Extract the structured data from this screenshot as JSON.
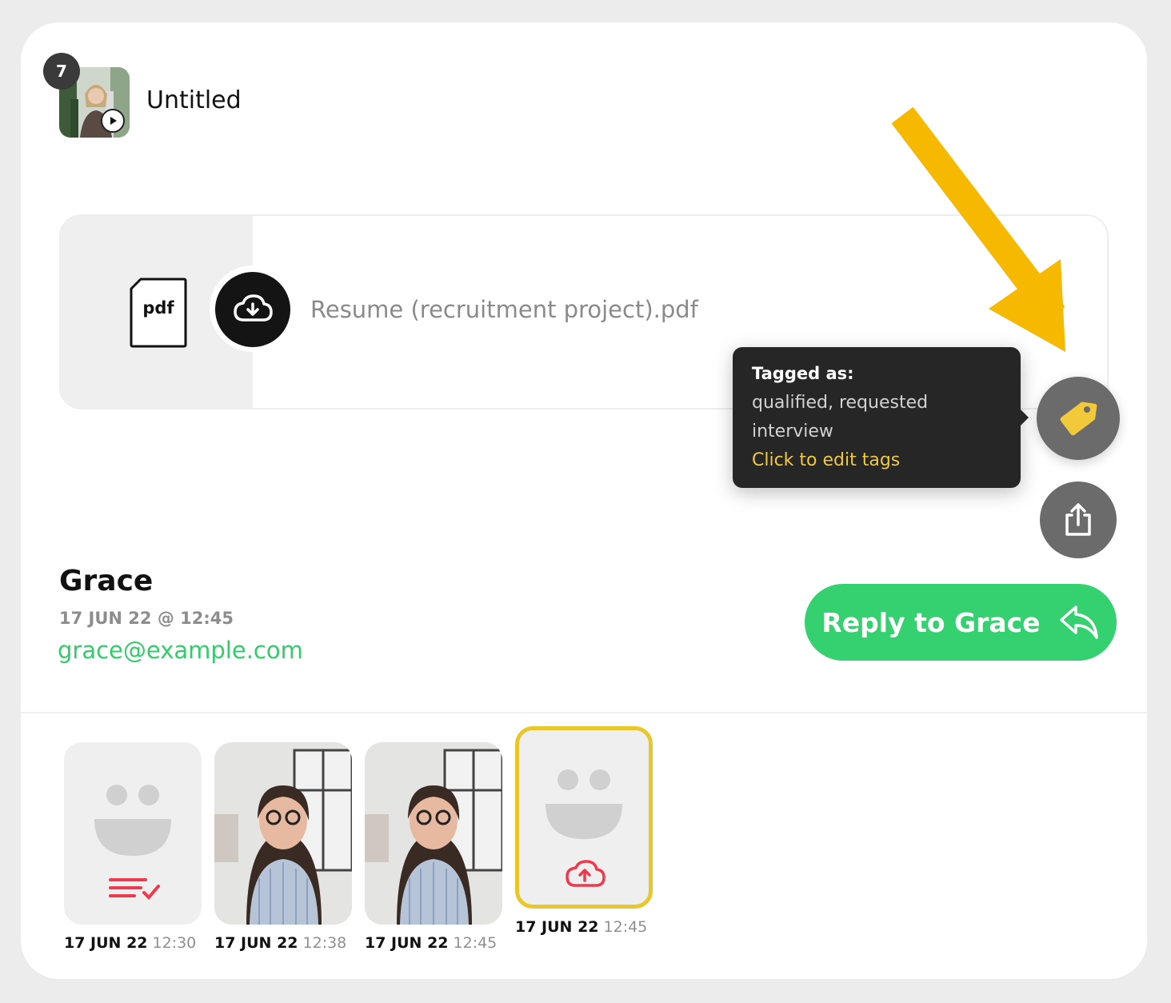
{
  "header": {
    "count": "7",
    "title": "Untitled"
  },
  "attachment": {
    "type_label": "pdf",
    "file_name": "Resume (recruitment project).pdf"
  },
  "tooltip": {
    "heading": "Tagged as:",
    "tags": "qualified, requested interview",
    "action": "Click to edit tags"
  },
  "person": {
    "name": "Grace",
    "date": "17 JUN 22 @ 12:45",
    "email": "grace@example.com"
  },
  "reply": {
    "label": "Reply to Grace"
  },
  "thumbnails": [
    {
      "date": "17 JUN 22",
      "time": "12:30",
      "kind": "text-response",
      "icon": "text-check-icon"
    },
    {
      "date": "17 JUN 22",
      "time": "12:38",
      "kind": "video"
    },
    {
      "date": "17 JUN 22",
      "time": "12:45",
      "kind": "video"
    },
    {
      "date": "17 JUN 22",
      "time": "12:45",
      "kind": "upload",
      "icon": "cloud-upload-icon",
      "selected": true
    }
  ],
  "colors": {
    "accent_green": "#35d06f",
    "tag_yellow": "#f2c93a",
    "annotation_arrow": "#f7b800",
    "alert_red": "#ee3a4c"
  }
}
